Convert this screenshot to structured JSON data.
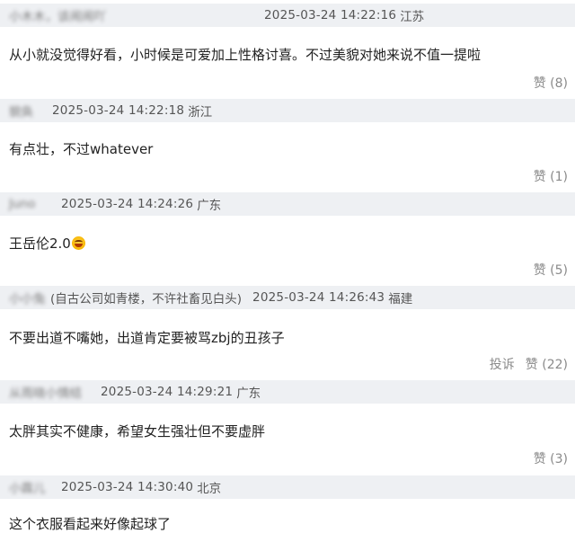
{
  "comments": [
    {
      "username": "小木木，该闹闹吖",
      "timestamp": "2025-03-24 14:22:16",
      "location": "江苏",
      "text": "从小就没觉得好看，小时候是可爱加上性格讨喜。不过美貌对她来说不值一提啦",
      "like_label": "赞 (8)"
    },
    {
      "username": "貌奂",
      "timestamp": "2025-03-24 14:22:18",
      "location": "浙江",
      "text": "有点壮，不过whatever",
      "like_label": "赞 (1)"
    },
    {
      "username": "Juno",
      "timestamp": "2025-03-24 14:24:26",
      "location": "广东",
      "text": "王岳伦2.0",
      "emoji": "laughing-emoji",
      "like_label": "赞 (5)"
    },
    {
      "username": "小小兔",
      "note": "(自古公司如青楼，不许社畜见白头)",
      "timestamp": "2025-03-24 14:26:43",
      "location": "福建",
      "text": "不要出道不嘴她，出道肯定要被骂zbj的丑孩子",
      "report_label": "投诉",
      "like_label": "赞 (22)"
    },
    {
      "username": "从雨晓小情结",
      "timestamp": "2025-03-24 14:29:21",
      "location": "广东",
      "text": "太胖其实不健康，希望女生强壮但不要虚胖",
      "like_label": "赞 (3)"
    },
    {
      "username": "小霖儿",
      "timestamp": "2025-03-24 14:30:40",
      "location": "北京",
      "text": "这个衣服看起来好像起球了"
    }
  ]
}
